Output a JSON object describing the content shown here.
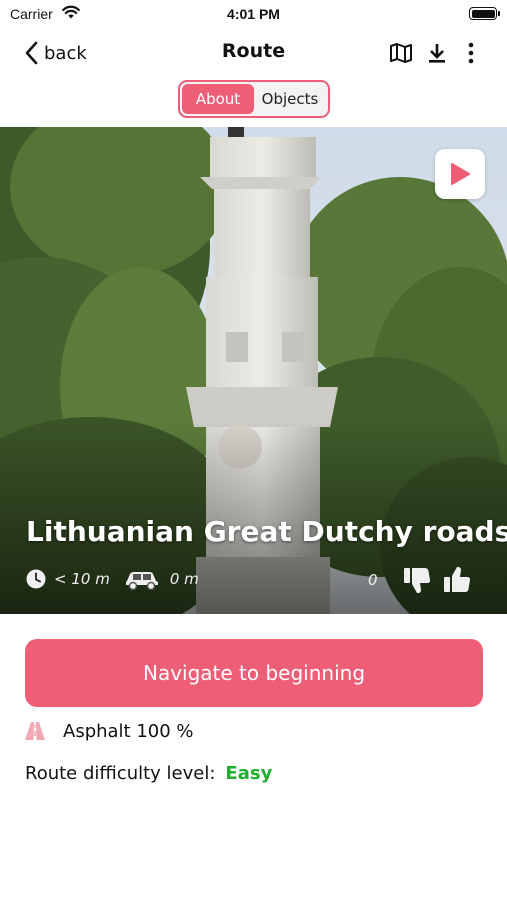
{
  "status_bar": {
    "carrier": "Carrier",
    "time": "4:01 PM"
  },
  "navbar": {
    "back_label": "back",
    "title": "Route",
    "icons": [
      "map-icon",
      "download-icon",
      "more-vertical-icon"
    ]
  },
  "tabs": [
    {
      "label": "About",
      "active": true
    },
    {
      "label": "Objects",
      "active": false
    }
  ],
  "hero": {
    "title": "Lithuanian Great Dutchy roads",
    "duration": "< 10 m",
    "distance": "0 m",
    "likes_count": "0",
    "icons": [
      "play-icon",
      "clock-icon",
      "car-icon",
      "thumbs-down-icon",
      "thumbs-up-icon"
    ]
  },
  "actions": {
    "navigate_label": "Navigate to beginning"
  },
  "route_info": {
    "surface": "Asphalt 100 %",
    "difficulty_label": "Route difficulty level:",
    "difficulty_value": "Easy"
  },
  "colors": {
    "accent": "#ef5e77",
    "difficulty_easy": "#1fae2d"
  }
}
